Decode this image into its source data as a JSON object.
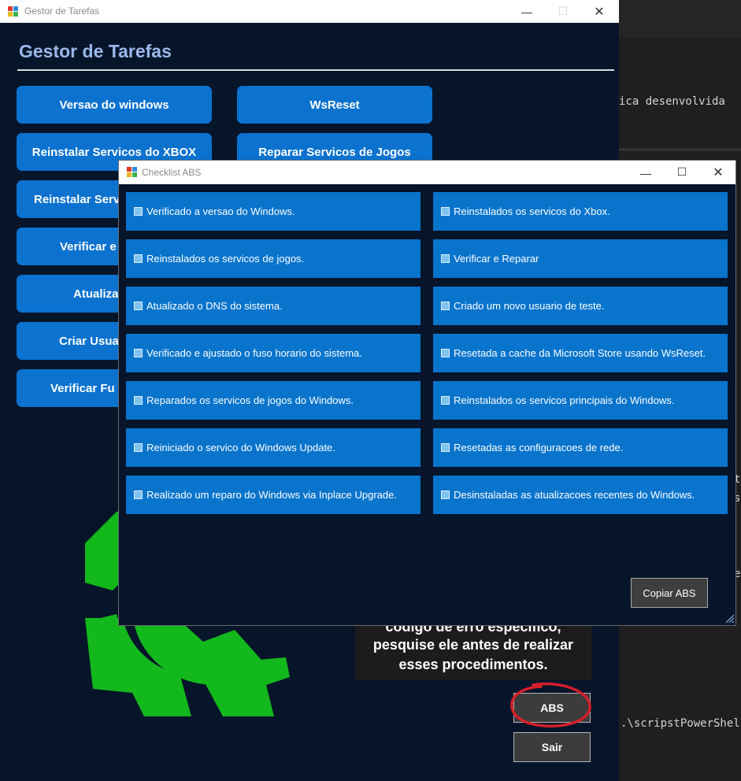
{
  "editor": {
    "lines": [
      "ica desenvolvida",
      "t",
      "s",
      "e",
      ".\\scripstPowerShell\\mai"
    ]
  },
  "main_window": {
    "title": "Gestor de Tarefas",
    "heading": "Gestor de Tarefas",
    "buttons": [
      "Versao do windows",
      "WsReset",
      "Reinstalar Servicos do XBOX",
      "Reparar Servicos de Jogos",
      "Reinstalar Serv",
      "Verificar e",
      "Atualiza",
      "Criar Usua",
      "Verificar Fu"
    ],
    "note_lines": [
      "codigo de erro especifico,",
      "pesquise ele antes de realizar",
      "esses procedimentos."
    ],
    "abs_label": "ABS",
    "sair_label": "Sair"
  },
  "checklist_window": {
    "title": "Checklist ABS",
    "items_left": [
      "Verificado a versao do Windows.",
      "Reinstalados os servicos de jogos.",
      "Atualizado o DNS do sistema.",
      "Verificado e ajustado o fuso horario do sistema.",
      "Reparados os servicos de jogos do Windows.",
      "Reiniciado o servico do Windows Update.",
      "Realizado um reparo do Windows via Inplace Upgrade."
    ],
    "items_right": [
      "Reinstalados os servicos do Xbox.",
      "Verificar e Reparar",
      "Criado um novo usuario de teste.",
      "Resetada a cache da Microsoft Store usando WsReset.",
      "Reinstalados os servicos principais do Windows.",
      "Resetadas as configuracoes de rede.",
      "Desinstaladas as atualizacoes recentes do Windows."
    ],
    "copy_label": "Copiar ABS"
  },
  "colors": {
    "accent_blue": "#0b72cf",
    "window_bg": "#07152a",
    "gear_green": "#13b81c",
    "annotation_red": "#d41f2a"
  }
}
